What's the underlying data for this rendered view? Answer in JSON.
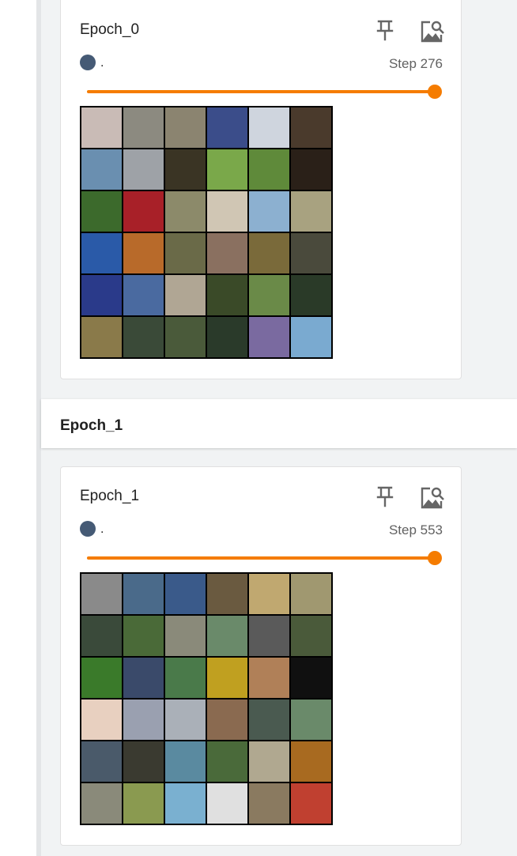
{
  "colors": {
    "accent": "#f57c00",
    "run_dot": "#455a75"
  },
  "cards": [
    {
      "title": "Epoch_0",
      "run_label": ".",
      "step": "Step 276",
      "slider_fraction": 1.0,
      "icons": [
        "pin-icon",
        "expand-image-icon"
      ],
      "image": "6x6 grid of small natural image thumbnails",
      "tiles": [
        [
          "#c9bbb6",
          "#8c8a80",
          "#8b8470",
          "#3b4d8a",
          "#cfd5de",
          "#4a3a2c"
        ],
        [
          "#6a8fb0",
          "#9ea2a7",
          "#3a3424",
          "#7aa84a",
          "#5f8a3a",
          "#2a2018"
        ],
        [
          "#3c6a2c",
          "#a82028",
          "#8c8a6a",
          "#d0c6b4",
          "#8cb0d0",
          "#a8a280"
        ],
        [
          "#2a5aa8",
          "#b86a2a",
          "#6a6a48",
          "#8a7060",
          "#7a6a3a",
          "#4a4a3c"
        ],
        [
          "#2a3a8a",
          "#4a6aa0",
          "#b0a694",
          "#3a4a28",
          "#6a8a48",
          "#2a3a28"
        ],
        [
          "#8a7a4a",
          "#3a4a38",
          "#4a5a3a",
          "#2a3a2a",
          "#7a6aa0",
          "#7aaad0"
        ]
      ]
    },
    {
      "title": "Epoch_1",
      "run_label": ".",
      "step": "Step 553",
      "slider_fraction": 1.0,
      "icons": [
        "pin-icon",
        "expand-image-icon"
      ],
      "image": "6x6 grid of small natural image thumbnails",
      "tiles": [
        [
          "#8a8a8a",
          "#4a6a8a",
          "#3a5a8a",
          "#6a5a40",
          "#c0a870",
          "#a09870"
        ],
        [
          "#3a4a3a",
          "#4a6a38",
          "#8a8a7a",
          "#6a8a6a",
          "#5a5a5a",
          "#4a5a3a"
        ],
        [
          "#3a7a2a",
          "#3a4a6a",
          "#4a7a4a",
          "#c0a020",
          "#b08058",
          "#101010"
        ],
        [
          "#e8d0c0",
          "#9aa0b0",
          "#aab0b8",
          "#8a6a50",
          "#4a5a50",
          "#6a8a6a"
        ],
        [
          "#4a5a6a",
          "#3a3a30",
          "#5a8aa0",
          "#4a6a3a",
          "#b0a890",
          "#a86a20"
        ],
        [
          "#8a8a7a",
          "#8a9a50",
          "#7ab0d0",
          "#e0e0e0",
          "#8a7a60",
          "#c04030"
        ]
      ]
    }
  ],
  "section": {
    "title": "Epoch_1"
  }
}
